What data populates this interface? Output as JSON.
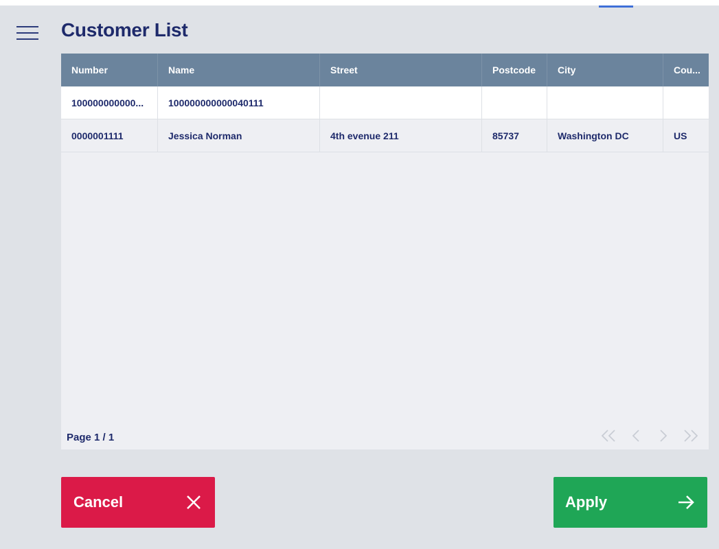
{
  "header": {
    "title": "Customer List",
    "menu_icon": "hamburger-menu-icon"
  },
  "table": {
    "columns": [
      "Number",
      "Name",
      "Street",
      "Postcode",
      "City",
      "Cou..."
    ],
    "rows": [
      {
        "number": "100000000000...",
        "name": "100000000000040111",
        "street": "",
        "postcode": "",
        "city": "",
        "country": ""
      },
      {
        "number": "0000001111",
        "name": "Jessica Norman",
        "street": "4th evenue 211",
        "postcode": "85737",
        "city": "Washington DC",
        "country": "US"
      }
    ]
  },
  "pagination": {
    "label": "Page 1 / 1",
    "icons": [
      "first-page-icon",
      "previous-page-icon",
      "next-page-icon",
      "last-page-icon"
    ]
  },
  "actions": {
    "cancel_label": "Cancel",
    "cancel_icon": "close-icon",
    "apply_label": "Apply",
    "apply_icon": "arrow-right-icon"
  },
  "colors": {
    "background": "#dfe2e7",
    "header_row": "#6b849d",
    "title_text": "#1e2a6b",
    "cancel": "#db1a48",
    "apply": "#1fa656"
  }
}
